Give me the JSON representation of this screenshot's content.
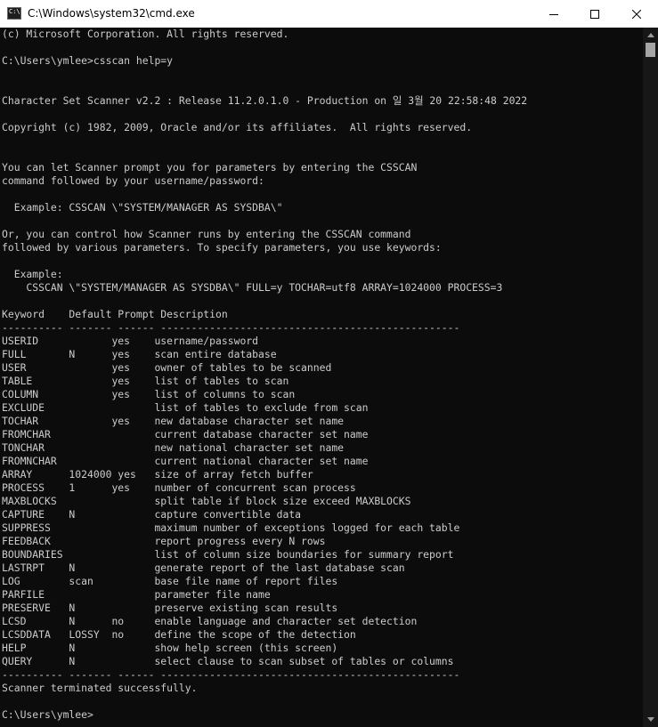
{
  "window": {
    "title": "C:\\Windows\\system32\\cmd.exe",
    "icon": "console-icon",
    "controls": {
      "minimize": "minimize-icon",
      "maximize": "maximize-icon",
      "close": "close-icon"
    }
  },
  "terminal": {
    "lines": [
      "(c) Microsoft Corporation. All rights reserved.",
      "",
      "C:\\Users\\ymlee>csscan help=y",
      "",
      "",
      "Character Set Scanner v2.2 : Release 11.2.0.1.0 - Production on 일 3월 20 22:58:48 2022",
      "",
      "Copyright (c) 1982, 2009, Oracle and/or its affiliates.  All rights reserved.",
      "",
      "",
      "You can let Scanner prompt you for parameters by entering the CSSCAN",
      "command followed by your username/password:",
      "",
      "  Example: CSSCAN \\\"SYSTEM/MANAGER AS SYSDBA\\\"",
      "",
      "Or, you can control how Scanner runs by entering the CSSCAN command",
      "followed by various parameters. To specify parameters, you use keywords:",
      "",
      "  Example:",
      "    CSSCAN \\\"SYSTEM/MANAGER AS SYSDBA\\\" FULL=y TOCHAR=utf8 ARRAY=1024000 PROCESS=3",
      "",
      "Keyword    Default Prompt Description",
      "---------- ------- ------ -------------------------------------------------",
      "USERID            yes    username/password",
      "FULL       N      yes    scan entire database",
      "USER              yes    owner of tables to be scanned",
      "TABLE             yes    list of tables to scan",
      "COLUMN            yes    list of columns to scan",
      "EXCLUDE                  list of tables to exclude from scan",
      "TOCHAR            yes    new database character set name",
      "FROMCHAR                 current database character set name",
      "TONCHAR                  new national character set name",
      "FROMNCHAR                current national character set name",
      "ARRAY      1024000 yes   size of array fetch buffer",
      "PROCESS    1      yes    number of concurrent scan process",
      "MAXBLOCKS                split table if block size exceed MAXBLOCKS",
      "CAPTURE    N             capture convertible data",
      "SUPPRESS                 maximum number of exceptions logged for each table",
      "FEEDBACK                 report progress every N rows",
      "BOUNDARIES               list of column size boundaries for summary report",
      "LASTRPT    N             generate report of the last database scan",
      "LOG        scan          base file name of report files",
      "PARFILE                  parameter file name",
      "PRESERVE   N             preserve existing scan results",
      "LCSD       N      no     enable language and character set detection",
      "LCSDDATA   LOSSY  no     define the scope of the detection",
      "HELP       N             show help screen (this screen)",
      "QUERY      N             select clause to scan subset of tables or columns",
      "---------- ------- ------ -------------------------------------------------",
      "Scanner terminated successfully.",
      "",
      "C:\\Users\\ymlee>"
    ]
  },
  "colors": {
    "terminal_background": "#0c0c0c",
    "terminal_text": "#cccccc",
    "titlebar": "#ffffff",
    "scroll_thumb": "#a6a6a6"
  }
}
